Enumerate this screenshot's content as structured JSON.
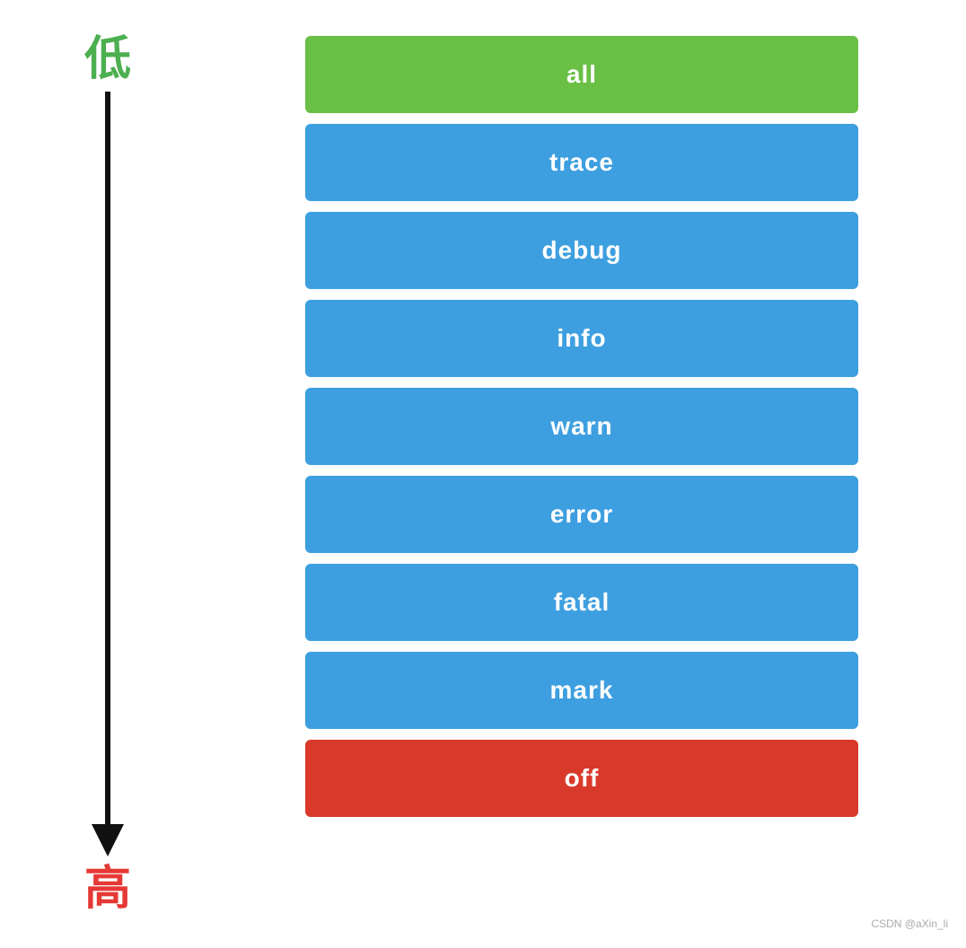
{
  "axis": {
    "label_low": "低",
    "label_high": "高"
  },
  "blocks": [
    {
      "id": "all",
      "label": "all",
      "style": "all"
    },
    {
      "id": "trace",
      "label": "trace",
      "style": "blue"
    },
    {
      "id": "debug",
      "label": "debug",
      "style": "blue"
    },
    {
      "id": "info",
      "label": "info",
      "style": "blue"
    },
    {
      "id": "warn",
      "label": "warn",
      "style": "blue"
    },
    {
      "id": "error",
      "label": "error",
      "style": "blue"
    },
    {
      "id": "fatal",
      "label": "fatal",
      "style": "blue"
    },
    {
      "id": "mark",
      "label": "mark",
      "style": "blue"
    },
    {
      "id": "off",
      "label": "off",
      "style": "off"
    }
  ],
  "watermark": {
    "text": "CSDN @aXin_li"
  }
}
